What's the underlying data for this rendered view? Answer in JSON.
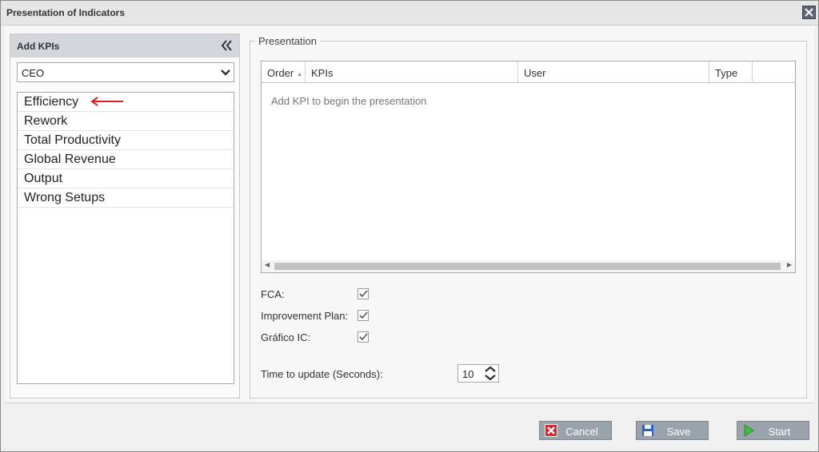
{
  "window": {
    "title": "Presentation of Indicators"
  },
  "left": {
    "header": "Add KPIs",
    "dropdown_value": "CEO",
    "kpis": [
      "Efficiency",
      "Rework",
      "Total Productivity",
      "Global Revenue",
      "Output",
      "Wrong Setups"
    ]
  },
  "presentation": {
    "legend": "Presentation",
    "columns": [
      "Order",
      "KPIs",
      "User",
      "Type"
    ],
    "empty_text": "Add KPI to begin the presentation",
    "options": [
      {
        "label": "FCA:",
        "checked": true
      },
      {
        "label": "Improvement Plan:",
        "checked": true
      },
      {
        "label": "Gráfico IC:",
        "checked": true
      }
    ],
    "time_label": "Time to update (Seconds):",
    "time_value": "10"
  },
  "footer": {
    "cancel": "Cancel",
    "save": "Save",
    "start": "Start"
  },
  "colors": {
    "button_bg": "#9aa2ab",
    "header_bg": "#d3d6db",
    "arrow_annotation": "#e02020"
  }
}
